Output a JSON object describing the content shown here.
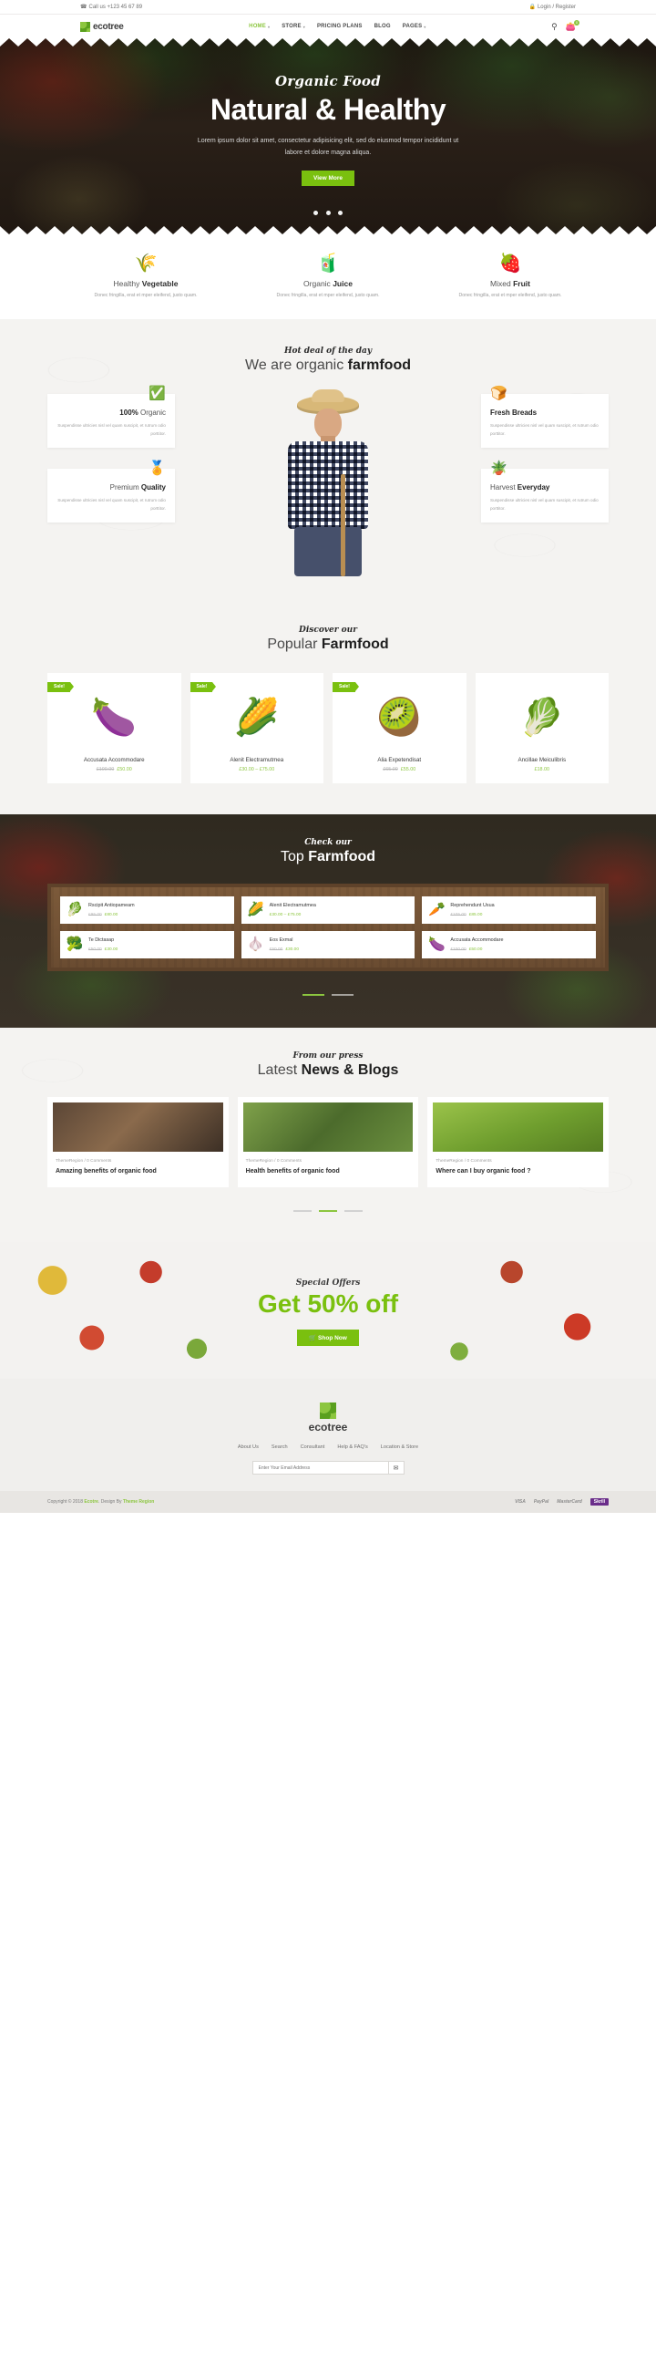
{
  "topbar": {
    "phone_icon": "phone-icon",
    "phone": "Call us +123 45 67 89",
    "account_icon": "lock-icon",
    "account": "Login / Register"
  },
  "nav": {
    "brand": "ecotree",
    "brand_icon": "ecotree-logo-icon",
    "items": [
      {
        "label": "HOME",
        "active": true,
        "caret": "▾"
      },
      {
        "label": "STORE",
        "active": false,
        "caret": "▾"
      },
      {
        "label": "PRICING PLANS",
        "active": false,
        "caret": ""
      },
      {
        "label": "BLOG",
        "active": false,
        "caret": ""
      },
      {
        "label": "PAGES",
        "active": false,
        "caret": "▾"
      }
    ],
    "search_icon": "search-icon",
    "cart_icon": "cart-icon",
    "cart_count": "0"
  },
  "hero": {
    "script": "Organic Food",
    "title": "Natural & Healthy",
    "subtitle": "Lorem ipsum dolor sit amet, consectetur adipisicing elit, sed do eiusmod tempor incididunt ut labore et dolore magna aliqua.",
    "button": "View More",
    "dots": 3
  },
  "features": [
    {
      "icon": "wheat-icon",
      "glyph": "🌾",
      "title_light": "Healthy",
      "title_bold": "Vegetable",
      "desc": "Donec fringilla, erat et mper eleifend, justo quam."
    },
    {
      "icon": "juice-glass-icon",
      "glyph": "🧃",
      "title_light": "Organic",
      "title_bold": "Juice",
      "desc": "Donec fringilla, erat et mper eleifend, justo quam."
    },
    {
      "icon": "fruit-veg-icon",
      "glyph": "🍓",
      "title_light": "Mixed",
      "title_bold": "Fruit",
      "desc": "Donec fringilla, erat et mper eleifend, justo quam."
    }
  ],
  "hotdeal": {
    "script": "Hot deal of the day",
    "title_light": "We are organic ",
    "title_bold": "farmfood",
    "cards": [
      {
        "icon": "green-badge-icon",
        "glyph": "✅",
        "title_bold": "100% ",
        "title_rest": "Organic",
        "bold_first": true,
        "desc": "Suspendisse ultricies nisl vel quam suscipit, et rutrum odio porttitor."
      },
      {
        "icon": "bread-icon",
        "glyph": "🍞",
        "title_bold": "Fresh Breads",
        "title_rest": "",
        "bold_first": true,
        "desc": "Suspendisse ultricies nisl vel quam suscipit, et rutrum odio porttitor."
      },
      {
        "icon": "star-badge-icon",
        "glyph": "🏅",
        "title_bold": "Premium ",
        "title_rest": "Quality",
        "bold_first": false,
        "desc": "Suspendisse ultricies nisl vel quam suscipit, et rutrum odio porttitor."
      },
      {
        "icon": "watering-can-icon",
        "glyph": "🪴",
        "title_bold": "Harvest ",
        "title_rest": "Everyday",
        "bold_first": false,
        "desc": "Suspendisse ultricies nisl vel quam suscipit, et rutrum odio porttitor."
      }
    ],
    "farmer_image": "farmer-photo"
  },
  "popular": {
    "script": "Discover our",
    "title_light": "Popular ",
    "title_bold": "Farmfood",
    "products": [
      {
        "sale": "Sale!",
        "on_sale": true,
        "icon": "eggplant-icon",
        "glyph": "🍆",
        "name": "Accusata Accommodare",
        "old_price": "£100.00",
        "new_price": "£50.00"
      },
      {
        "sale": "Sale!",
        "on_sale": true,
        "icon": "corn-icon",
        "glyph": "🌽",
        "name": "Alenit Electramutmea",
        "old_price": "",
        "new_price": "£30.00 – £75.00"
      },
      {
        "sale": "Sale!",
        "on_sale": true,
        "icon": "kiwi-icon",
        "glyph": "🥝",
        "name": "Alia Expetendisat",
        "old_price": "£65.00",
        "new_price": "£55.00"
      },
      {
        "sale": "",
        "on_sale": false,
        "icon": "leek-icon",
        "glyph": "🥬",
        "name": "Ancillae Meiculibris",
        "old_price": "",
        "new_price": "£18.00"
      }
    ]
  },
  "topfood": {
    "script": "Check our",
    "title_light": "Top ",
    "title_bold": "Farmfood",
    "items": [
      {
        "icon": "green-onion-icon",
        "glyph": "🥬",
        "name": "Rscipit Antiopameam",
        "old_price": "£95.00",
        "new_price": "£80.00"
      },
      {
        "icon": "corn-icon",
        "glyph": "🌽",
        "name": "Alenit Electramutmea",
        "old_price": "",
        "new_price": "£30.00 – £75.00"
      },
      {
        "icon": "carrot-icon",
        "glyph": "🥕",
        "name": "Reprehendunt Usua",
        "old_price": "£105.00",
        "new_price": "£85.00"
      },
      {
        "icon": "broccoli-icon",
        "glyph": "🥦",
        "name": "Te Dictasap",
        "old_price": "£50.00",
        "new_price": "£30.00"
      },
      {
        "icon": "ginger-icon",
        "glyph": "🧄",
        "name": "Eos Exmal",
        "old_price": "£50.00",
        "new_price": "£30.00"
      },
      {
        "icon": "eggplant-icon",
        "glyph": "🍆",
        "name": "Accusata Accommodare",
        "old_price": "£100.00",
        "new_price": "£50.00"
      }
    ],
    "dots": [
      true,
      false
    ]
  },
  "blog": {
    "script": "From our press",
    "title_light": "Latest ",
    "title_bold": "News & Blogs",
    "posts": [
      {
        "image": "coffee-desk-photo",
        "author": "ThemeRegion",
        "comments": "0 Comments",
        "title": "Amazing benefits of organic food"
      },
      {
        "image": "vineyard-photo",
        "author": "ThemeRegion",
        "comments": "0 Comments",
        "title": "Health benefits of organic food"
      },
      {
        "image": "rice-field-photo",
        "author": "ThemeRegion",
        "comments": "0 Comments",
        "title": "Where can I buy organic food ?"
      }
    ],
    "dots": [
      false,
      true,
      false
    ]
  },
  "offer": {
    "script": "Special Offers",
    "title": "Get 50% off",
    "button": "🛒  Shop Now"
  },
  "footer": {
    "logo_icon": "ecotree-logo-icon",
    "logo": "ecotree",
    "links": [
      "About Us",
      "Search",
      "Consultant",
      "Help & FAQ's",
      "Location & Store"
    ],
    "email_placeholder": "Enter Your Email Address",
    "submit_icon": "envelope-icon",
    "copyright_pre": "Copyright © 2018 ",
    "copyright_brand": "Ecotre",
    "copyright_mid": ". Design By ",
    "copyright_author": "Theme Region",
    "payments": [
      "VISA",
      "PayPal",
      "MasterCard",
      "Skrill"
    ]
  },
  "colors": {
    "accent": "#8cc63f",
    "button": "#7ac00f",
    "dark": "#2a2018"
  }
}
